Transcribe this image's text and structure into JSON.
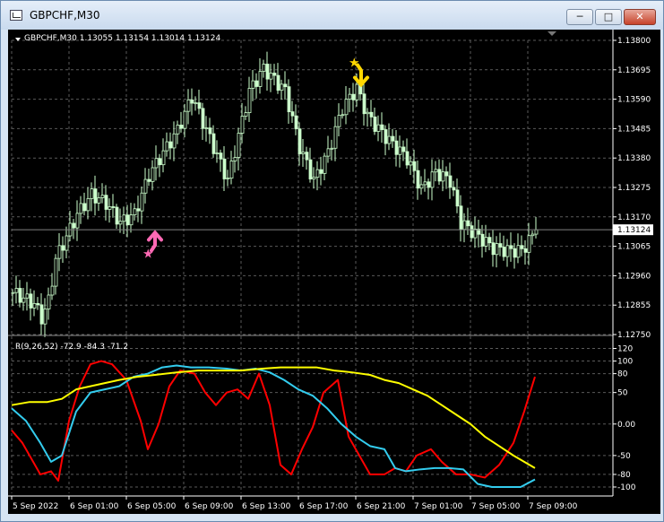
{
  "window": {
    "title": "GBPCHF,M30",
    "minimize_icon": "minimize-icon",
    "maximize_icon": "maximize-icon",
    "close_icon": "close-icon"
  },
  "colors": {
    "background": "#000000",
    "grid": "#5a5a5a",
    "candle": "#ccffcc",
    "axis_text": "#ffffff",
    "price_line": "#808080",
    "buy_arrow": "#ff69b4",
    "sell_arrow": "#ffd700",
    "red_line": "#ff0000",
    "cyan_line": "#33ccee",
    "yellow_line": "#ffff00"
  },
  "chart_data": [
    {
      "type": "candlestick",
      "header": "GBPCHF,M30  1.13055 1.13154 1.13014 1.13124",
      "current_price_label": "1.13124",
      "current_price": 1.13124,
      "y_ticks": [
        "1.13800",
        "1.13695",
        "1.13590",
        "1.13485",
        "1.13380",
        "1.13275",
        "1.13170",
        "1.13065",
        "1.12960",
        "1.12855",
        "1.12750"
      ],
      "ylim": [
        1.1275,
        1.138
      ],
      "grid": true,
      "close_path": [
        [
          0,
          1.129
        ],
        [
          6,
          1.1286
        ],
        [
          8,
          1.1281
        ],
        [
          10,
          1.1287
        ],
        [
          12,
          1.1302
        ],
        [
          15,
          1.131
        ],
        [
          18,
          1.1318
        ],
        [
          22,
          1.1325
        ],
        [
          26,
          1.1322
        ],
        [
          30,
          1.1315
        ],
        [
          34,
          1.1318
        ],
        [
          38,
          1.1332
        ],
        [
          42,
          1.134
        ],
        [
          46,
          1.1348
        ],
        [
          50,
          1.136
        ],
        [
          55,
          1.1345
        ],
        [
          60,
          1.133
        ],
        [
          66,
          1.1362
        ],
        [
          70,
          1.137
        ],
        [
          76,
          1.1362
        ],
        [
          80,
          1.1342
        ],
        [
          84,
          1.133
        ],
        [
          88,
          1.134
        ],
        [
          92,
          1.1356
        ],
        [
          96,
          1.1363
        ],
        [
          99,
          1.1353
        ],
        [
          103,
          1.1347
        ],
        [
          106,
          1.1343
        ],
        [
          110,
          1.1338
        ],
        [
          114,
          1.1327
        ],
        [
          118,
          1.1333
        ],
        [
          122,
          1.133
        ],
        [
          125,
          1.1315
        ],
        [
          130,
          1.131
        ],
        [
          134,
          1.1306
        ],
        [
          138,
          1.1305
        ],
        [
          142,
          1.1305
        ],
        [
          146,
          1.1312
        ]
      ],
      "arrows": [
        {
          "kind": "buy",
          "bar": 40,
          "price": 1.13085
        },
        {
          "kind": "sell",
          "bar": 97,
          "price": 1.1368
        }
      ]
    },
    {
      "type": "line",
      "header": "R(9,26,52) -72.9 -84.3 -71.2",
      "y_ticks": [
        "120",
        "100",
        "80",
        "50",
        "0.00",
        "-50",
        "-80",
        "-100"
      ],
      "ylim": [
        -110,
        125
      ],
      "grid": true,
      "x_tick_labels": [
        "5 Sep 2022",
        "6 Sep 01:00",
        "6 Sep 05:00",
        "6 Sep 09:00",
        "6 Sep 13:00",
        "6 Sep 17:00",
        "6 Sep 21:00",
        "7 Sep 01:00",
        "7 Sep 05:00",
        "7 Sep 09:00"
      ],
      "x_tick_bars": [
        0,
        16,
        32,
        48,
        64,
        80,
        96,
        112,
        128,
        144
      ],
      "series": [
        {
          "color": "red",
          "points": [
            [
              0,
              -10
            ],
            [
              3,
              -30
            ],
            [
              6,
              -60
            ],
            [
              8,
              -80
            ],
            [
              11,
              -75
            ],
            [
              13,
              -90
            ],
            [
              16,
              5
            ],
            [
              19,
              60
            ],
            [
              22,
              95
            ],
            [
              25,
              100
            ],
            [
              28,
              95
            ],
            [
              32,
              70
            ],
            [
              36,
              5
            ],
            [
              38,
              -40
            ],
            [
              41,
              0
            ],
            [
              44,
              60
            ],
            [
              47,
              85
            ],
            [
              51,
              80
            ],
            [
              54,
              50
            ],
            [
              57,
              30
            ],
            [
              60,
              50
            ],
            [
              63,
              55
            ],
            [
              66,
              40
            ],
            [
              69,
              80
            ],
            [
              72,
              30
            ],
            [
              75,
              -65
            ],
            [
              78,
              -80
            ],
            [
              81,
              -40
            ],
            [
              84,
              -5
            ],
            [
              87,
              50
            ],
            [
              91,
              70
            ],
            [
              94,
              -20
            ],
            [
              97,
              -50
            ],
            [
              100,
              -80
            ],
            [
              104,
              -80
            ],
            [
              107,
              -70
            ],
            [
              110,
              -75
            ],
            [
              113,
              -50
            ],
            [
              117,
              -40
            ],
            [
              120,
              -60
            ],
            [
              124,
              -80
            ],
            [
              128,
              -80
            ],
            [
              132,
              -85
            ],
            [
              136,
              -65
            ],
            [
              140,
              -30
            ],
            [
              143,
              20
            ],
            [
              146,
              75
            ]
          ]
        },
        {
          "color": "cyan",
          "points": [
            [
              0,
              25
            ],
            [
              4,
              5
            ],
            [
              8,
              -30
            ],
            [
              11,
              -60
            ],
            [
              14,
              -50
            ],
            [
              18,
              20
            ],
            [
              22,
              50
            ],
            [
              26,
              55
            ],
            [
              30,
              60
            ],
            [
              34,
              75
            ],
            [
              38,
              80
            ],
            [
              42,
              90
            ],
            [
              46,
              93
            ],
            [
              50,
              90
            ],
            [
              55,
              90
            ],
            [
              60,
              88
            ],
            [
              64,
              85
            ],
            [
              68,
              88
            ],
            [
              72,
              82
            ],
            [
              76,
              70
            ],
            [
              80,
              55
            ],
            [
              84,
              45
            ],
            [
              88,
              25
            ],
            [
              92,
              0
            ],
            [
              96,
              -20
            ],
            [
              100,
              -35
            ],
            [
              104,
              -40
            ],
            [
              107,
              -70
            ],
            [
              110,
              -75
            ],
            [
              114,
              -72
            ],
            [
              118,
              -70
            ],
            [
              122,
              -70
            ],
            [
              126,
              -72
            ],
            [
              130,
              -95
            ],
            [
              134,
              -100
            ],
            [
              138,
              -100
            ],
            [
              142,
              -100
            ],
            [
              146,
              -88
            ]
          ]
        },
        {
          "color": "yellow",
          "points": [
            [
              0,
              30
            ],
            [
              5,
              35
            ],
            [
              10,
              35
            ],
            [
              14,
              40
            ],
            [
              18,
              55
            ],
            [
              22,
              60
            ],
            [
              26,
              65
            ],
            [
              30,
              70
            ],
            [
              35,
              75
            ],
            [
              40,
              78
            ],
            [
              46,
              82
            ],
            [
              52,
              85
            ],
            [
              58,
              85
            ],
            [
              64,
              85
            ],
            [
              70,
              88
            ],
            [
              75,
              90
            ],
            [
              80,
              90
            ],
            [
              85,
              90
            ],
            [
              90,
              85
            ],
            [
              95,
              82
            ],
            [
              100,
              78
            ],
            [
              104,
              70
            ],
            [
              108,
              65
            ],
            [
              112,
              55
            ],
            [
              116,
              45
            ],
            [
              120,
              30
            ],
            [
              124,
              15
            ],
            [
              128,
              0
            ],
            [
              132,
              -20
            ],
            [
              136,
              -35
            ],
            [
              140,
              -50
            ],
            [
              143,
              -60
            ],
            [
              146,
              -70
            ]
          ]
        }
      ]
    }
  ]
}
